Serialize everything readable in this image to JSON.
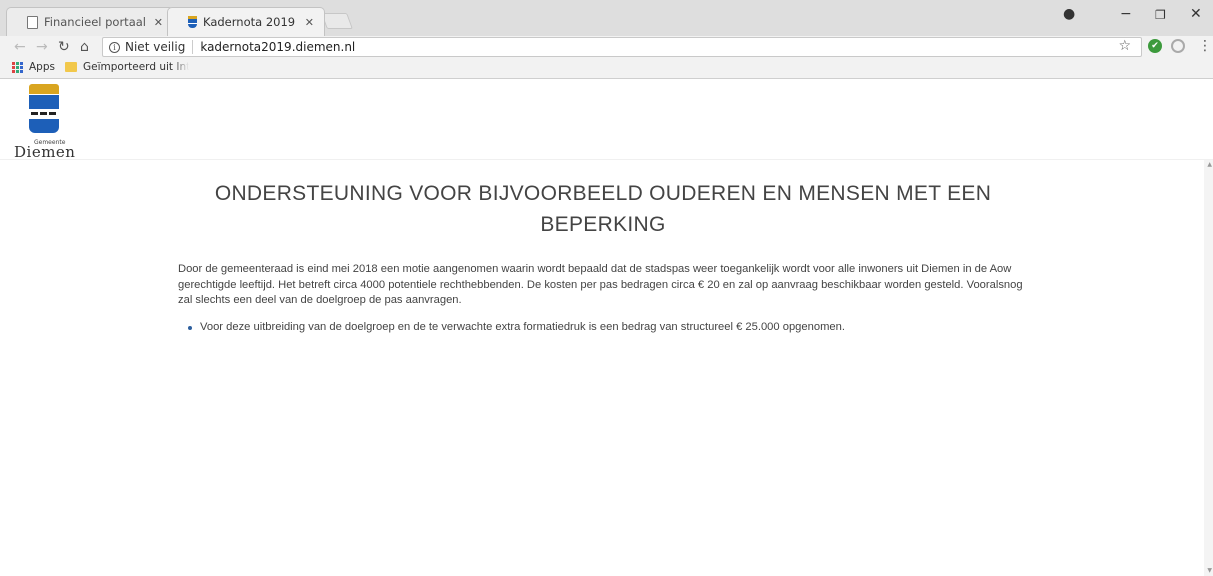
{
  "browser": {
    "tabs": [
      {
        "label": "Financieel portaal gemee"
      },
      {
        "label": "Kadernota 2019"
      }
    ],
    "security_label": "Niet veilig",
    "url": "kadernota2019.diemen.nl",
    "bookmarks": [
      {
        "label": "Apps"
      },
      {
        "label": "Geïmporteerd uit Inte"
      }
    ]
  },
  "site": {
    "logo_small": "Gemeente",
    "logo_name": "Diemen"
  },
  "page": {
    "title": "ONDERSTEUNING VOOR BIJVOORBEELD OUDEREN EN MENSEN MET EEN BEPERKING",
    "paragraph": "Door de gemeenteraad is eind mei 2018 een motie aangenomen waarin wordt bepaald dat de stadspas weer toegankelijk wordt voor alle inwoners uit Diemen in de Aow gerechtigde leeftijd. Het betreft circa 4000 potentiele rechthebbenden. De kosten per pas bedragen circa € 20 en zal op aanvraag beschikbaar worden gesteld. Vooralsnog zal slechts een deel van de doelgroep de pas aanvragen.",
    "bullets": [
      "Voor deze uitbreiding van de doelgroep en de te verwachte extra formatiedruk is een bedrag van structureel € 25.000 opgenomen."
    ]
  }
}
